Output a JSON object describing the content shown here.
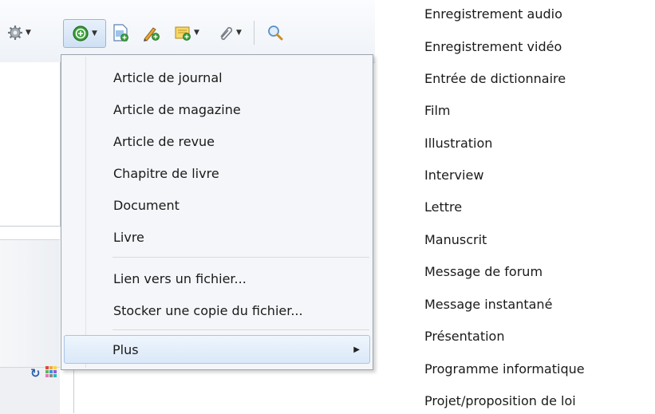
{
  "toolbar": {
    "buttons": [
      {
        "icon": "gear-icon",
        "has_dropdown": true
      },
      {
        "icon": "new-item-icon",
        "has_dropdown": true,
        "active": true
      },
      {
        "icon": "new-note-icon",
        "has_dropdown": false
      },
      {
        "icon": "edit-tag-icon",
        "has_dropdown": false
      },
      {
        "icon": "standalone-note-icon",
        "has_dropdown": true
      },
      {
        "icon": "attachment-icon",
        "has_dropdown": true
      },
      {
        "icon": "search-icon",
        "has_dropdown": false
      }
    ]
  },
  "menu": {
    "items": [
      "Article de journal",
      "Article de magazine",
      "Article de revue",
      "Chapitre de livre",
      "Document",
      "Livre"
    ],
    "file_items": [
      "Lien vers un fichier...",
      "Stocker une copie du fichier..."
    ],
    "more_label": "Plus"
  },
  "submenu": {
    "items": [
      "Enregistrement audio",
      "Enregistrement vidéo",
      "Entrée de dictionnaire",
      "Film",
      "Illustration",
      "Interview",
      "Lettre",
      "Manuscrit",
      "Message de forum",
      "Message instantané",
      "Présentation",
      "Programme informatique",
      "Projet/proposition de loi"
    ]
  },
  "colors": {
    "highlight_border": "#a9c4e6",
    "menu_background": "#f4f6f9",
    "add_icon_green": "#3aa13a"
  }
}
